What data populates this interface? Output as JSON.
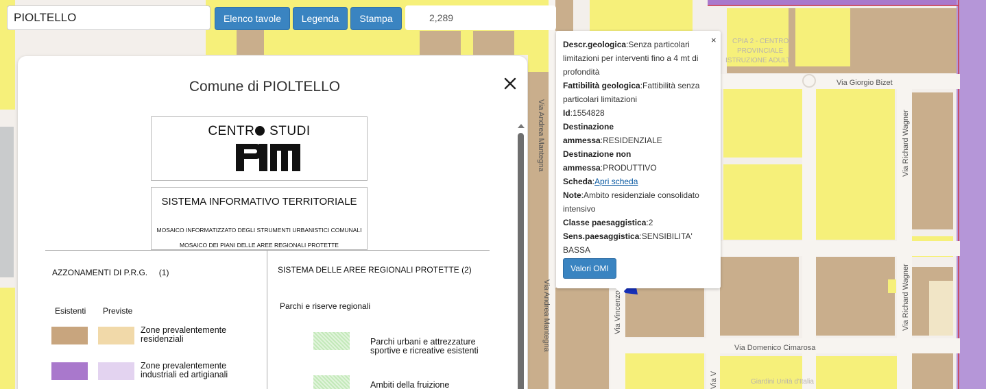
{
  "search": {
    "value": "PIOLTELLO"
  },
  "toolbar": {
    "elenco_label": "Elenco tavole",
    "legenda_label": "Legenda",
    "stampa_label": "Stampa",
    "scale_value": "2,289"
  },
  "legend": {
    "title": "Comune di PIOLTELLO",
    "logo_text_left": "CENTR",
    "logo_text_right": "STUDI",
    "logo_mark": "PIM",
    "sit_title": "SISTEMA INFORMATIVO TERRITORIALE",
    "sit_sub1": "MOSAICO INFORMATIZZATO DEGLI STRUMENTI URBANISTICI COMUNALI",
    "sit_sub2": "MOSAICO DEI PIANI DELLE AREE REGIONALI PROTETTE",
    "azzonamenti": "AZZONAMENTI DI P.R.G.     (1)",
    "sistema_aree": "SISTEMA DELLE AREE REGIONALI PROTETTE (2)",
    "esistenti": "Esistenti",
    "previste": "Previste",
    "parchi_riserve": "Parchi e riserve regionali",
    "items": [
      {
        "label": "Zone prevalentemente residenziali",
        "color_existing": "#c8a57e",
        "color_planned": "#f1d9a9"
      },
      {
        "label": "Zone prevalentemente industriali ed artigianali",
        "color_existing": "#a978cc",
        "color_planned": "#e3d3f0"
      }
    ],
    "park_items": [
      {
        "label": "Parchi urbani e attrezzature sportive e ricreative esistenti",
        "color": "#b9e6ad"
      },
      {
        "label": "Ambiti della fruizione",
        "color": "#b9e6ad"
      }
    ]
  },
  "popup": {
    "rows": [
      {
        "key": "Descr.geologica",
        "value": "Senza particolari limitazioni per interventi fino a 4 mt di profondità"
      },
      {
        "key": "Fattibilità geologica",
        "value": "Fattibilità senza particolari limitazioni"
      },
      {
        "key": "Id",
        "value": "1554828"
      },
      {
        "key": "Destinazione ammessa",
        "value": "RESIDENZIALE"
      },
      {
        "key": "Destinazione non ammessa",
        "value": "PRODUTTIVO"
      },
      {
        "key": "Scheda",
        "value": "Apri scheda"
      },
      {
        "key": "Note",
        "value": "Ambito residenziale consolidato intensivo"
      },
      {
        "key": "Classe paesaggistica",
        "value": "2"
      },
      {
        "key": "Sens.paesaggistica",
        "value": "SENSIBILITA' BASSA"
      }
    ],
    "close": "×",
    "button_label": "Valori OMI"
  },
  "map": {
    "streets": {
      "via_andrea_mantegna": "Via Andrea Mantegna",
      "via_giorgio_bizet": "Via Giorgio Bizet",
      "via_richard_wagner": "Via Richard Wagner",
      "via_domenico_cimarosa": "Via Domenico Cimarosa",
      "via_vincenzo": "Via Vincenzo",
      "via_v": "Via V"
    },
    "poi": {
      "cpia_line1": "CPIA 2 - CENTRO",
      "cpia_line2": "PROVINCIALE",
      "cpia_line3": "ISTRUZIONE ADULT",
      "giardini": "Giardini Unità d'Italia"
    },
    "colors": {
      "residential_existing": "#f6f07a",
      "residential_built": "#c9ae8c",
      "industrial": "#b596d8",
      "road": "#f7f4f0"
    }
  }
}
